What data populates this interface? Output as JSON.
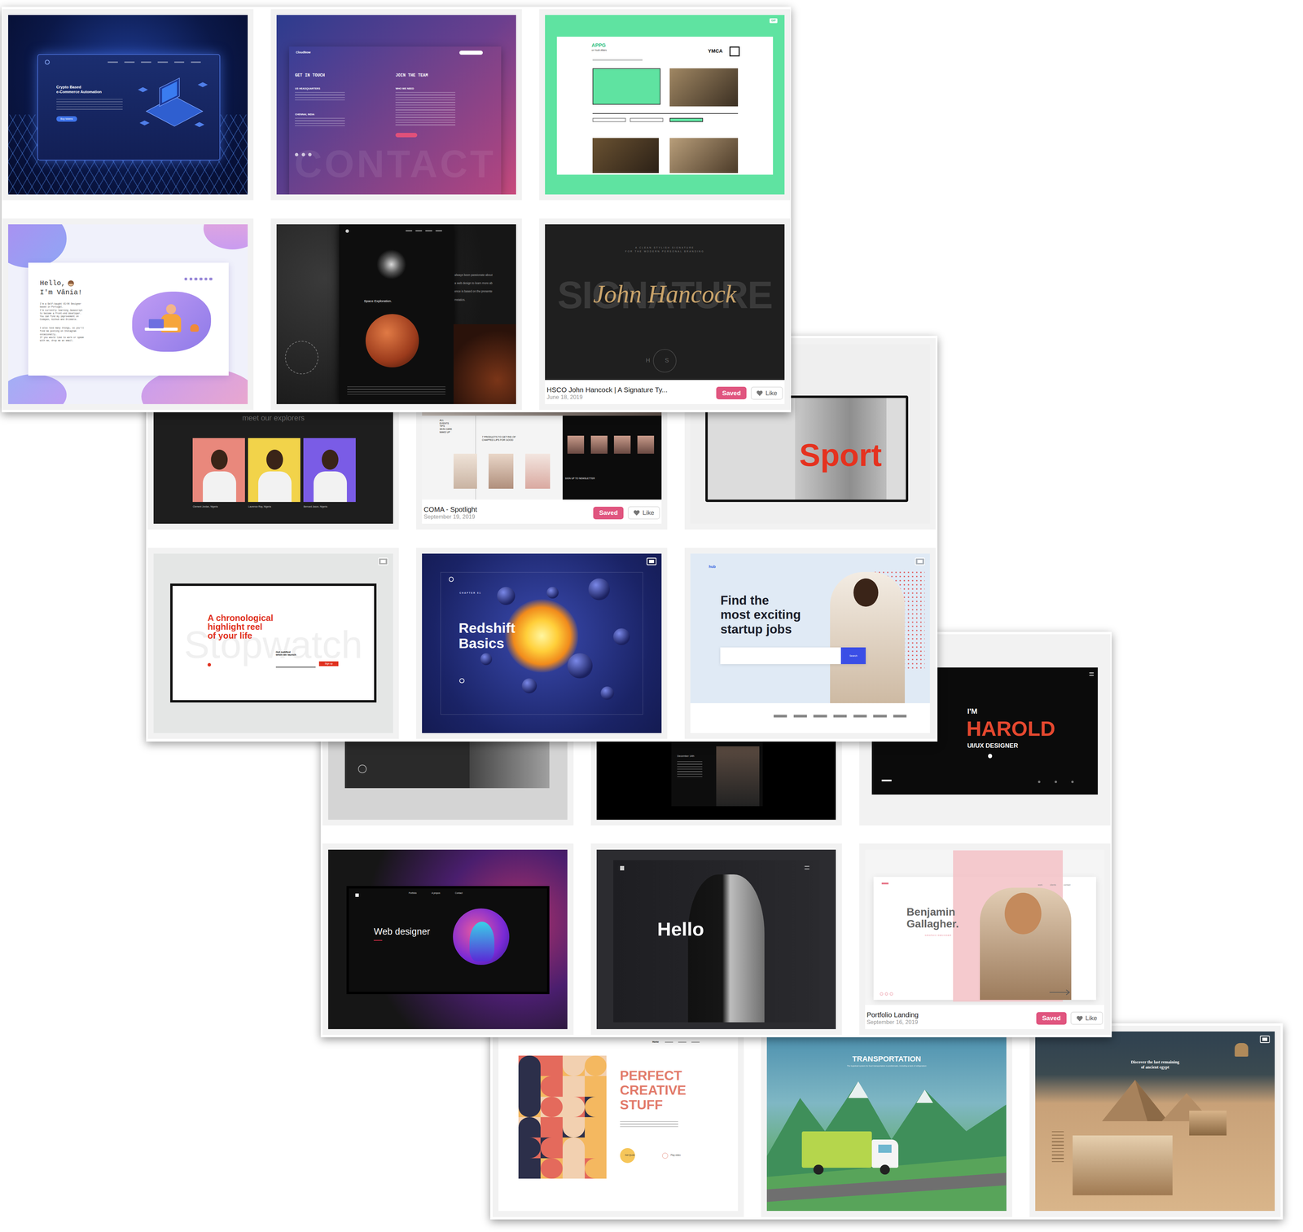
{
  "panels": [
    {
      "cards": [
        {
          "kind": "crypto",
          "texts": {
            "title": [
              "Crypto Based",
              "e-Commerce Automation"
            ],
            "button": "Buy tokens"
          }
        },
        {
          "kind": "cloudnow",
          "texts": {
            "logo": "CloudNow",
            "left_heading": "GET IN TOUCH",
            "right_heading": "JOIN THE TEAM",
            "office_1": "US HEADQUARTERS",
            "office_2": "CHENNAI, INDIA",
            "right_sub": "WHO WE NEED",
            "watermark": "CONTACT"
          }
        },
        {
          "kind": "appg",
          "badge": "GIF",
          "texts": {
            "logo": "APPG",
            "logo_sub": "on Youth Affairs",
            "partner": "YMCA"
          }
        },
        {
          "kind": "vania",
          "texts": {
            "greeting": "Hello,",
            "name": "I'm Vânia!",
            "body_1": [
              "I'm a Self-taught UI/UX Designer",
              "based in Portugal.",
              "I'm currently learning Javascript",
              "to become a front-end developer.",
              "You can find my improvement on",
              "Codepen, Github and Dribbble."
            ],
            "body_2": [
              "I also love many things, so you'll",
              "find me posting on Instagram",
              "occasionally.",
              "If you would like to work or speak",
              "with me, drop me an email."
            ]
          }
        },
        {
          "kind": "space",
          "texts": {
            "title": "Space Exploration.",
            "side": [
              "always been passionate about",
              "a web design to learn more ab",
              "ence is based on the presente",
              "rretatics."
            ]
          }
        },
        {
          "kind": "signature",
          "texts": {
            "tagline": [
              "A CLEAN STYLISH SIGNATURE",
              "FOR THE MODERN PERSONAL BRANDING"
            ],
            "word": "SIGNATURE",
            "script": "John Hancock",
            "mark": "HS"
          },
          "caption": {
            "title": "HSCO John Hancock | A Signature Ty...",
            "date": "June 18, 2019",
            "save_label": "Saved",
            "saved": true,
            "like_label": "Like"
          }
        }
      ]
    },
    {
      "cards": [
        {
          "kind": "explorers",
          "texts": {
            "heading": "meet our explorers",
            "people": [
              "Clement Jordan, Nigeria",
              "Laurence Ray, Nigeria",
              "Bernard Jason, Nigeria"
            ]
          }
        },
        {
          "kind": "coma",
          "texts": {
            "categories": [
              "ALL",
              "EVENTS",
              "TIPS",
              "SKIN CARE",
              "MAKE UP"
            ],
            "title": [
              "7 PRODUCTS TO GET RID OF",
              "CHAPPED LIPS FOR GOOD"
            ],
            "signup": "SIGN UP TO NEWSLETTER"
          },
          "caption": {
            "title": "COMA - Spotlight",
            "date": "September 19, 2019",
            "save_label": "Saved",
            "saved": true,
            "like_label": "Like"
          }
        },
        {
          "kind": "sport",
          "texts": {
            "word": "Sport"
          }
        },
        {
          "kind": "stopwatch",
          "video": true,
          "texts": {
            "watermark": "Stopwatch",
            "headline": [
              "A chronological",
              "highlight reel",
              "of your life"
            ],
            "notify": [
              "Get notified",
              "when we launch"
            ],
            "button": "Sign up"
          }
        },
        {
          "kind": "redshift",
          "video": true,
          "texts": {
            "chapter": "CHAPTER 01",
            "title": [
              "Redshift",
              "Basics"
            ]
          }
        },
        {
          "kind": "hub",
          "video": true,
          "texts": {
            "logo": "hub",
            "headline": [
              "Find the",
              "most exciting",
              "startup jobs"
            ],
            "button": "Search"
          }
        }
      ]
    },
    {
      "cards": [
        {
          "kind": "darkphoto",
          "texts": {}
        },
        {
          "kind": "event",
          "texts": {
            "date": "December 14th"
          }
        },
        {
          "kind": "harold",
          "texts": {
            "watermark": "AI",
            "intro": "I'M",
            "name": "HAROLD",
            "role": "UI/UX DESIGNER"
          }
        },
        {
          "kind": "webdesigner",
          "texts": {
            "title": "Web designer",
            "nav": [
              "Portfolio",
              "A propos",
              "Contact"
            ]
          }
        },
        {
          "kind": "hello",
          "texts": {
            "word": "Hello"
          }
        },
        {
          "kind": "benjamin",
          "texts": {
            "name": [
              "Benjamin",
              "Gallagher."
            ],
            "role": "GRAPHIC DESIGNER",
            "nav": [
              "work",
              "clients",
              "contact"
            ]
          },
          "caption": {
            "title": "Portfolio Landing",
            "date": "September 16, 2019",
            "save_label": "Saved",
            "saved": true,
            "like_label": "Like"
          }
        }
      ]
    },
    {
      "cards": [
        {
          "kind": "perfect",
          "texts": {
            "nav": "Home",
            "title": [
              "PERFECT",
              "CREATIVE",
              "STUFF"
            ],
            "quote": "Get Quote",
            "play": "Play video"
          }
        },
        {
          "kind": "transport",
          "texts": {
            "title": "TRANSPORTATION",
            "subtitle": "The logistical system for food transportation is problematic, including a lack of refrigeration"
          }
        },
        {
          "kind": "egypt",
          "video": true,
          "texts": {
            "title": [
              "Discover the last remaining",
              "of ancient egypt"
            ]
          }
        }
      ]
    }
  ]
}
